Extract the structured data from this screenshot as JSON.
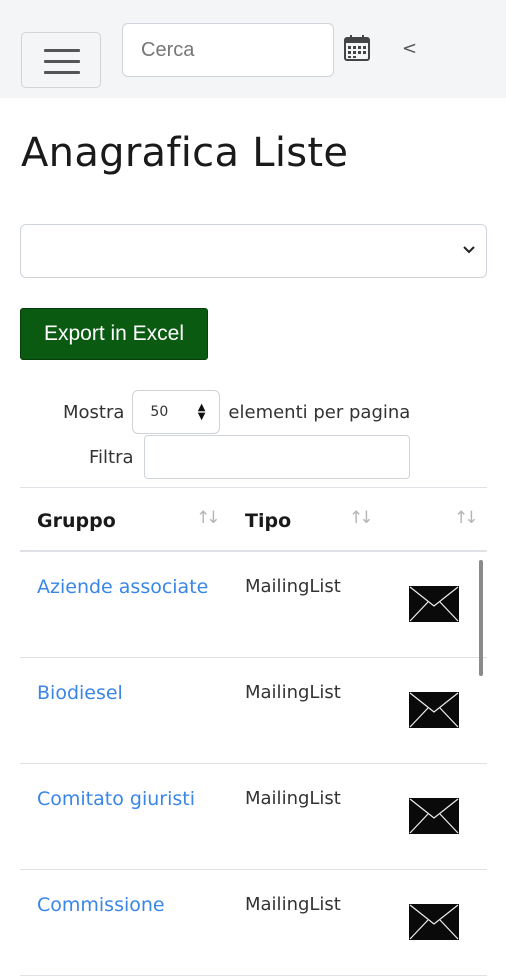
{
  "header": {
    "search_placeholder": "Cerca",
    "icons": [
      "menu-icon",
      "calendar-icon",
      "chevron-left-icon"
    ],
    "collapse_glyph": "<"
  },
  "page": {
    "title": "Anagrafica Liste",
    "select_value": "",
    "export_label": "Export in Excel"
  },
  "table_controls": {
    "show_label": "Mostra",
    "page_size": "50",
    "per_page_label": "elementi per pagina",
    "filter_label": "Filtra",
    "filter_value": ""
  },
  "table": {
    "columns": [
      "Gruppo",
      "Tipo",
      ""
    ],
    "rows": [
      {
        "gruppo": "Aziende associate",
        "tipo": "MailingList",
        "action_icon": "envelope-icon"
      },
      {
        "gruppo": "Biodiesel",
        "tipo": "MailingList",
        "action_icon": "envelope-icon"
      },
      {
        "gruppo": "Comitato giuristi",
        "tipo": "MailingList",
        "action_icon": "envelope-icon"
      },
      {
        "gruppo": "Commissione",
        "tipo": "MailingList",
        "action_icon": "envelope-icon"
      }
    ]
  },
  "colors": {
    "topbar_bg": "#f4f5f7",
    "export_button": "#0a5a12",
    "link": "#3a86e8"
  }
}
